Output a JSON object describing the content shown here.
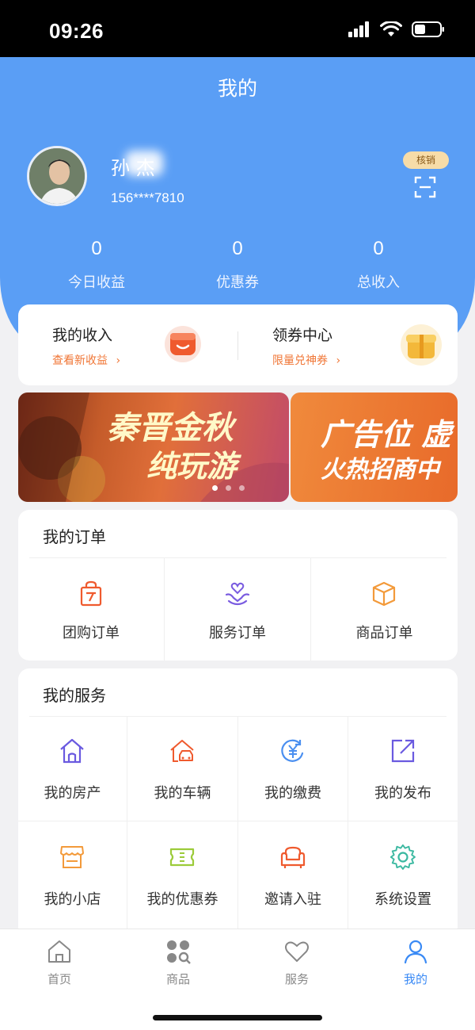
{
  "status_bar": {
    "time": "09:26"
  },
  "header": {
    "title": "我的"
  },
  "user": {
    "name": "孙  杰",
    "phone": "156****7810",
    "verify_badge": "核销"
  },
  "stats": [
    {
      "value": "0",
      "label": "今日收益"
    },
    {
      "value": "0",
      "label": "优惠券"
    },
    {
      "value": "0",
      "label": "总收入"
    }
  ],
  "income_card": {
    "left": {
      "title": "我的收入",
      "link": "查看新收益"
    },
    "right": {
      "title": "领券中心",
      "link": "限量兑神券"
    }
  },
  "banners": [
    {
      "line1": "秦晋金秋",
      "line2": "纯玩游"
    },
    {
      "line1": "广告位 虚",
      "line2": "火热招商中"
    }
  ],
  "orders": {
    "title": "我的订单",
    "items": [
      {
        "label": "团购订单",
        "icon": "group-buy-bag-icon"
      },
      {
        "label": "服务订单",
        "icon": "service-hands-heart-icon"
      },
      {
        "label": "商品订单",
        "icon": "product-box-icon"
      }
    ]
  },
  "services": {
    "title": "我的服务",
    "items": [
      {
        "label": "我的房产",
        "icon": "house-icon"
      },
      {
        "label": "我的车辆",
        "icon": "car-garage-icon"
      },
      {
        "label": "我的缴费",
        "icon": "yuan-payment-icon"
      },
      {
        "label": "我的发布",
        "icon": "publish-edit-icon"
      },
      {
        "label": "我的小店",
        "icon": "shop-icon"
      },
      {
        "label": "我的优惠券",
        "icon": "coupon-icon"
      },
      {
        "label": "邀请入驻",
        "icon": "sofa-icon"
      },
      {
        "label": "系统设置",
        "icon": "gear-icon"
      }
    ]
  },
  "tabbar": [
    {
      "label": "首页",
      "icon": "home-icon"
    },
    {
      "label": "商品",
      "icon": "grid-search-icon"
    },
    {
      "label": "服务",
      "icon": "heart-icon"
    },
    {
      "label": "我的",
      "icon": "person-icon"
    }
  ],
  "colors": {
    "primary_blue": "#5a9ef5",
    "accent_orange": "#f07636",
    "tab_active": "#3a8af5"
  }
}
